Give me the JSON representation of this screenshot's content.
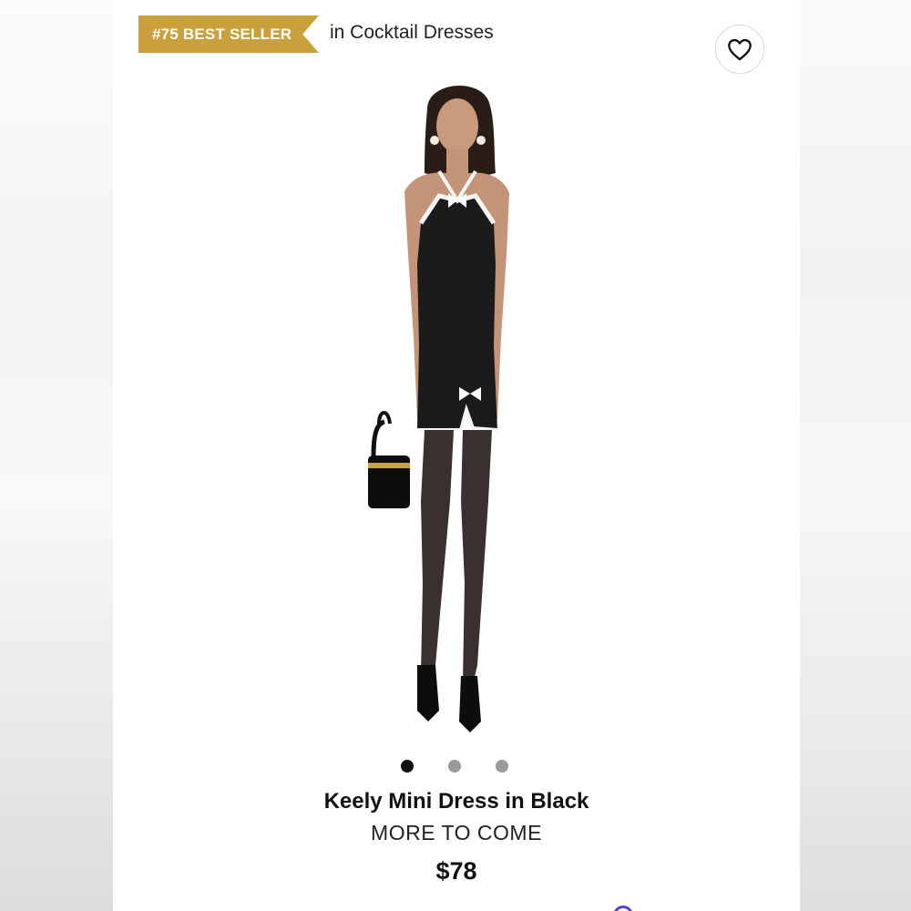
{
  "badge": {
    "label": "#75 BEST SELLER"
  },
  "category": {
    "text": "in Cocktail Dresses"
  },
  "favorite": {
    "icon": "heart-outline-icon"
  },
  "product": {
    "name": "Keely Mini Dress in Black",
    "brand": "MORE TO COME",
    "price": "$78"
  },
  "gallery": {
    "total_images": 3,
    "active_index": 0
  },
  "colors": {
    "badge": "#c9a03c",
    "active_dot": "#111111",
    "inactive_dot": "#9a9a9a"
  }
}
